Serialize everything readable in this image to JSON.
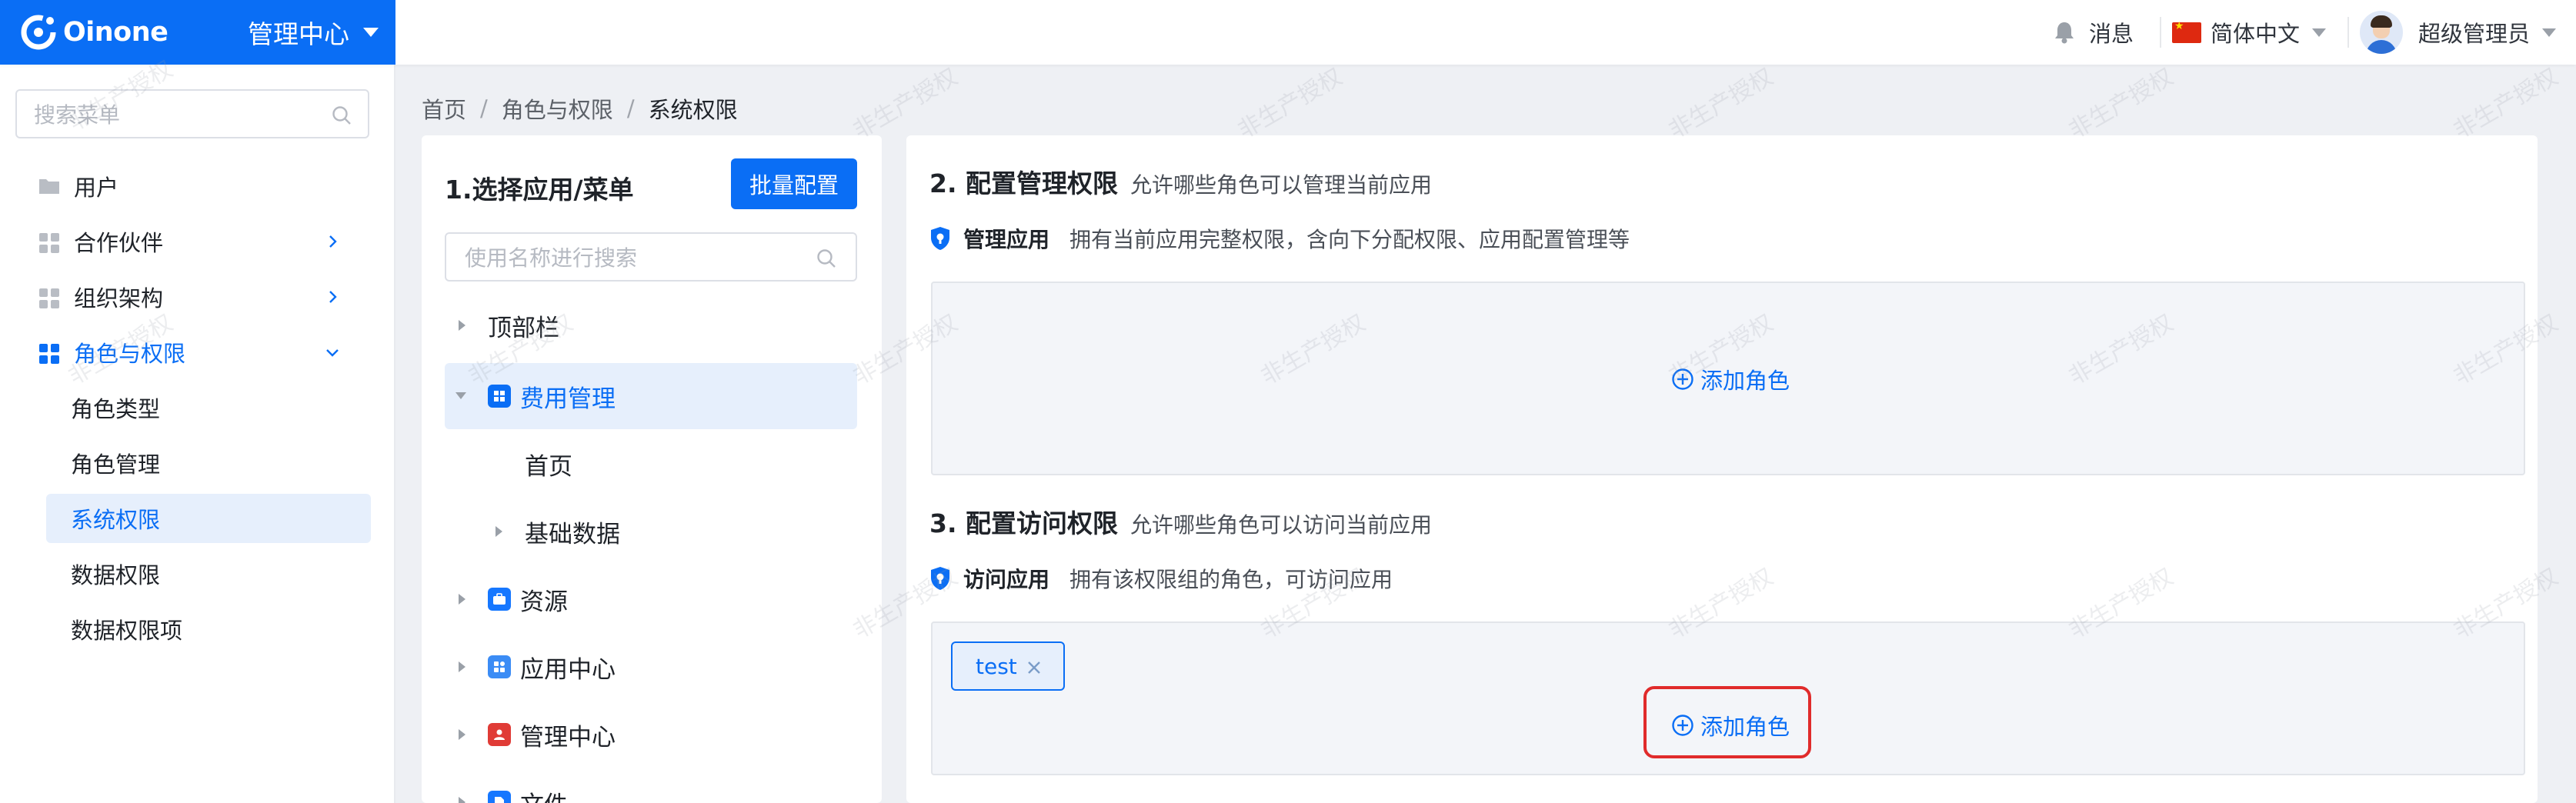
{
  "brand": {
    "name": "Oinone",
    "app_switch": "管理中心"
  },
  "topbar": {
    "messages": "消息",
    "language": "简体中文",
    "user": "超级管理员"
  },
  "sidebar": {
    "search_placeholder": "搜索菜单",
    "items": [
      {
        "label": "用户"
      },
      {
        "label": "合作伙伴"
      },
      {
        "label": "组织架构"
      },
      {
        "label": "角色与权限"
      }
    ],
    "sub_items": [
      {
        "label": "角色类型"
      },
      {
        "label": "角色管理"
      },
      {
        "label": "系统权限"
      },
      {
        "label": "数据权限"
      },
      {
        "label": "数据权限项"
      }
    ]
  },
  "breadcrumb": {
    "home": "首页",
    "parent": "角色与权限",
    "current": "系统权限"
  },
  "left_panel": {
    "title": "1.选择应用/菜单",
    "batch_button": "批量配置",
    "search_placeholder": "使用名称进行搜索",
    "nodes": [
      {
        "label": "顶部栏"
      },
      {
        "label": "费用管理"
      },
      {
        "label": "首页"
      },
      {
        "label": "基础数据"
      },
      {
        "label": "资源"
      },
      {
        "label": "应用中心"
      },
      {
        "label": "管理中心"
      },
      {
        "label": "文件"
      }
    ]
  },
  "right_panel": {
    "manage": {
      "title": "2. 配置管理权限",
      "desc": "允许哪些角色可以管理当前应用",
      "perm_name": "管理应用",
      "perm_desc": "拥有当前应用完整权限，含向下分配权限、应用配置管理等",
      "add_role": "添加角色"
    },
    "access": {
      "title": "3. 配置访问权限",
      "desc": "允许哪些角色可以访问当前应用",
      "perm_name": "访问应用",
      "perm_desc": "拥有该权限组的角色，可访问应用",
      "tag": "test",
      "add_role": "添加角色"
    }
  },
  "watermark": "非生产授权",
  "colors": {
    "primary": "#0a6ef5",
    "highlight": "#e02b2b"
  }
}
